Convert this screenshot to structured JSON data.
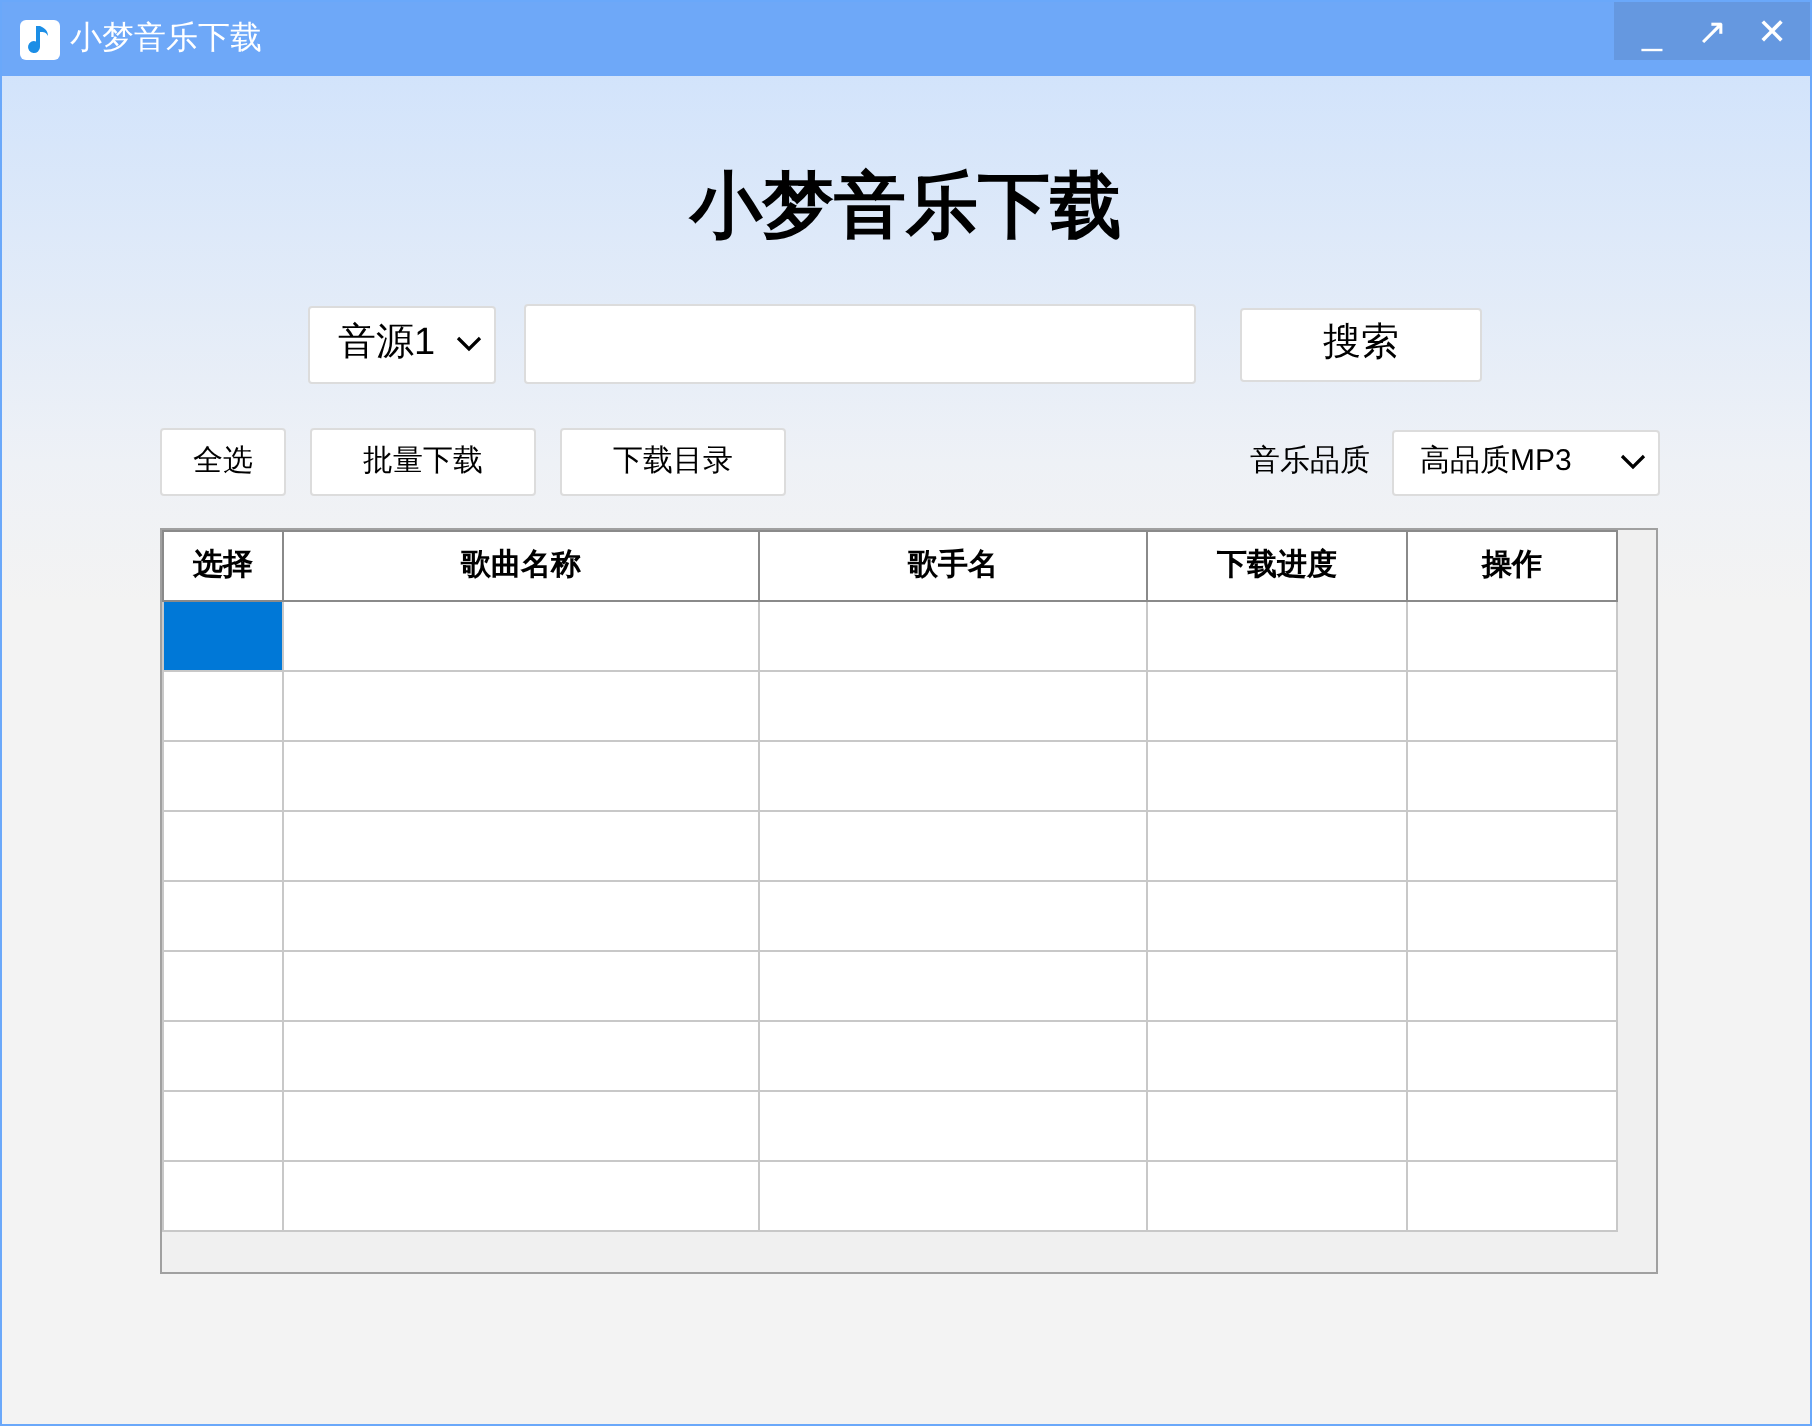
{
  "window": {
    "title": "小梦音乐下载",
    "controls": [
      "_",
      "↗",
      "✕"
    ]
  },
  "heading": "小梦音乐下载",
  "search": {
    "source": "音源1",
    "button": "搜索"
  },
  "toolbar": {
    "buttons": [
      "全选",
      "批量下载",
      "下载目录"
    ],
    "quality_label": "音乐品质",
    "quality": "高品质MP3"
  },
  "table": {
    "columns": [
      "选择",
      "歌曲名称",
      "歌手名",
      "下载进度",
      "操作"
    ],
    "rows": [
      {
        "selected": true
      },
      {
        "selected": false
      },
      {
        "selected": false
      },
      {
        "selected": false
      },
      {
        "selected": false
      },
      {
        "selected": false
      },
      {
        "selected": false
      },
      {
        "selected": false
      },
      {
        "selected": false
      }
    ]
  }
}
